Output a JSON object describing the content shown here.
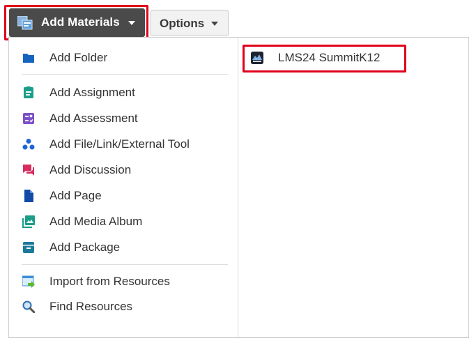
{
  "toolbar": {
    "add_materials_label": "Add Materials",
    "options_label": "Options"
  },
  "menu": {
    "items": [
      {
        "label": "Add Folder",
        "icon": "folder-icon",
        "color": "#1565c0"
      },
      {
        "label": "Add Assignment",
        "icon": "assignment-icon",
        "color": "#1a9e8a"
      },
      {
        "label": "Add Assessment",
        "icon": "assessment-icon",
        "color": "#7b50c9"
      },
      {
        "label": "Add File/Link/External Tool",
        "icon": "file-link-icon",
        "color": "#1e64d6"
      },
      {
        "label": "Add Discussion",
        "icon": "discussion-icon",
        "color": "#d62d5e"
      },
      {
        "label": "Add Page",
        "icon": "page-icon",
        "color": "#124aa8"
      },
      {
        "label": "Add Media Album",
        "icon": "media-album-icon",
        "color": "#1a9e8a"
      },
      {
        "label": "Add Package",
        "icon": "package-icon",
        "color": "#1b7a9a"
      },
      {
        "label": "Import from Resources",
        "icon": "import-resources-icon",
        "color": "#3a8fd6"
      },
      {
        "label": "Find Resources",
        "icon": "magnifier-icon",
        "color": "#2f6fb5"
      }
    ],
    "external_tool": {
      "label": "LMS24 SummitK12",
      "icon": "summitk12-logo-icon"
    }
  },
  "colors": {
    "highlight": "#e0001b",
    "primary_button": "#4a4a4a"
  }
}
